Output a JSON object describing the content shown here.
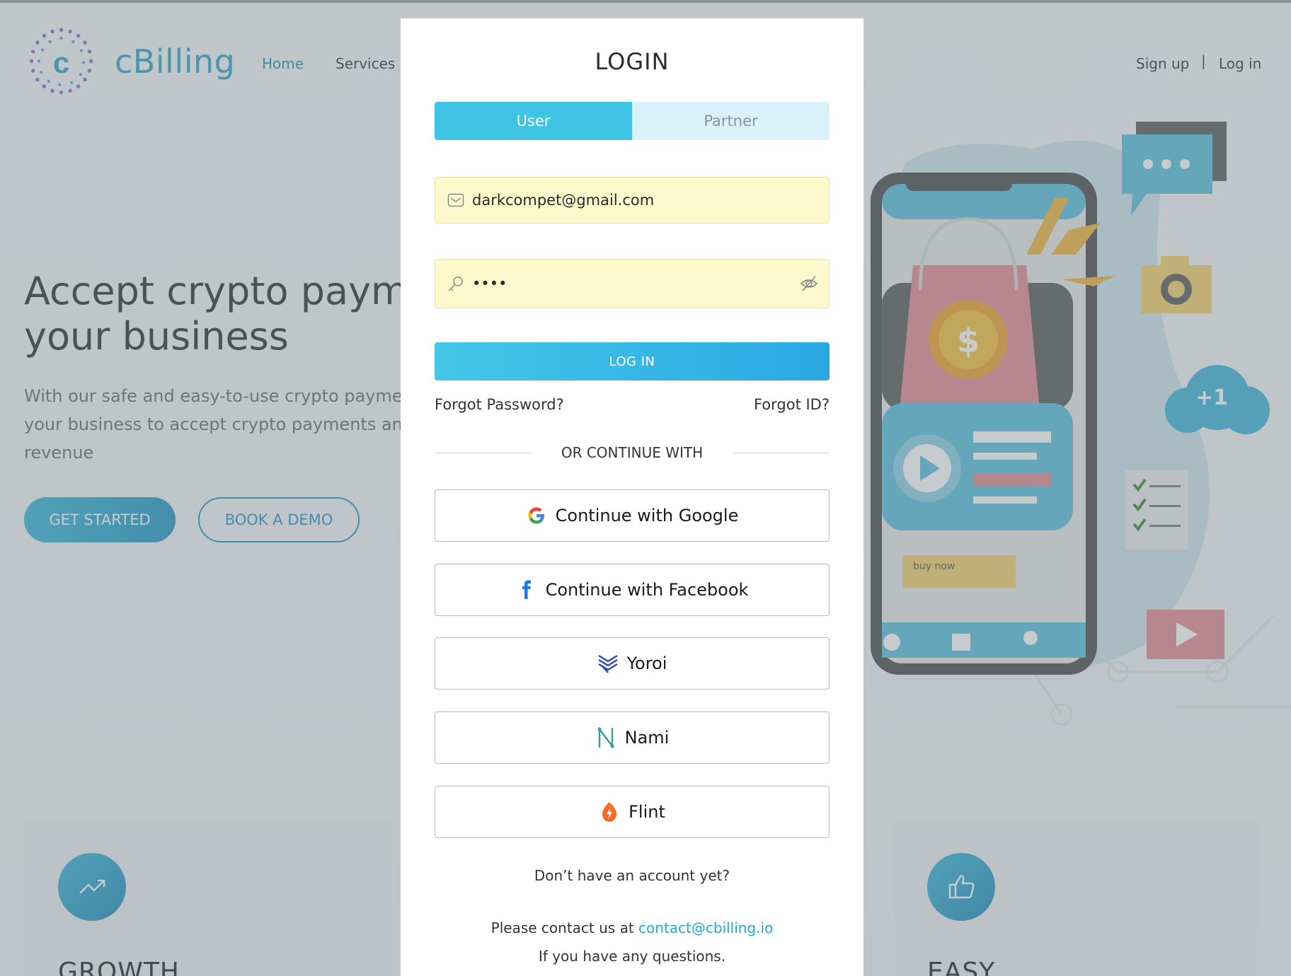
{
  "site": {
    "brand": "cBilling",
    "nav": {
      "home": "Home",
      "services": "Services"
    },
    "auth": {
      "signup": "Sign up",
      "separator": "|",
      "login": "Log in"
    },
    "hero": {
      "title_line1": "Accept crypto paym",
      "title_line2": "your business",
      "desc_line1": "With our safe and easy-to-use crypto payme",
      "desc_line2": "your business to accept crypto payments an",
      "desc_line3": "revenue",
      "get_started": "GET STARTED",
      "book_demo": "BOOK A DEMO"
    },
    "cards": [
      {
        "title": "GROWTH",
        "icon": "trend-up-icon"
      },
      {
        "title": "EASY",
        "icon": "thumbs-up-icon"
      }
    ],
    "illustration": {
      "buy_now": "buy now",
      "badge": "+1"
    }
  },
  "login": {
    "title": "LOGIN",
    "tabs": {
      "user": "User",
      "partner": "Partner",
      "active": "User"
    },
    "email": {
      "value": "darkcompet@gmail.com",
      "icon": "envelope-icon"
    },
    "password": {
      "value": "••••",
      "icon": "key-icon",
      "toggle_icon": "eye-off-icon"
    },
    "submit": "LOG IN",
    "forgot_password": "Forgot Password?",
    "forgot_id": "Forgot ID?",
    "divider": "OR CONTINUE WITH",
    "providers": {
      "google": "Continue with Google",
      "facebook": "Continue with Facebook",
      "yoroi": "Yoroi",
      "nami": "Nami",
      "flint": "Flint"
    },
    "no_account": "Don’t have an account yet?",
    "contact_prefix": "Please contact us at ",
    "contact_email": "contact@cbilling.io",
    "questions": "If you have any questions."
  },
  "colors": {
    "accent": "#40c4e6",
    "accent_dark": "#1d97c6",
    "autofill": "#fdf9cd",
    "link": "#22a9d8"
  }
}
